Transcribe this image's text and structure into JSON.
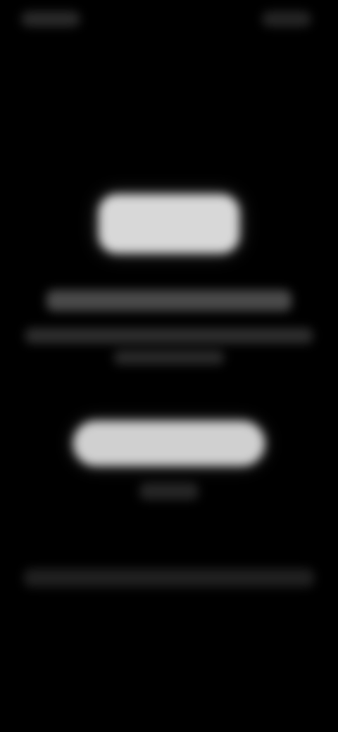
{
  "screen": {
    "state": "blurred",
    "background_color": "#000000"
  },
  "status_bar": {
    "left_text": "",
    "right_text": ""
  },
  "hero": {
    "label": ""
  },
  "content": {
    "headline": "",
    "body_line_1": "",
    "body_line_2": ""
  },
  "actions": {
    "primary_label": "",
    "secondary_label": ""
  },
  "footer": {
    "text": ""
  },
  "colors": {
    "hero_fill": "#d8d8d8",
    "primary_button_fill": "#d0d0d0",
    "headline_fill": "#4a4a4a"
  }
}
